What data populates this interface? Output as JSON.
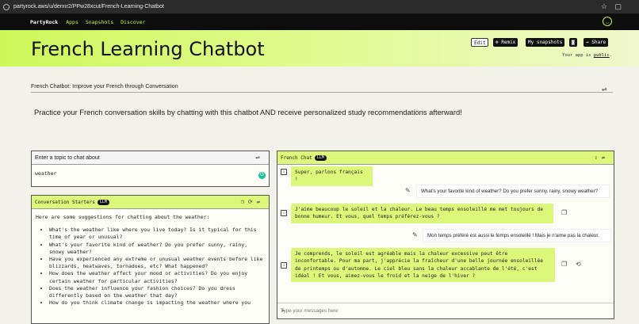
{
  "browser": {
    "url": "partyrock.aws/u/dennr2/PPw28xcut/French-Learning-Chatbot"
  },
  "nav": {
    "brand": "PartyRock",
    "links": [
      "Apps",
      "Snapshots",
      "Discover"
    ]
  },
  "header": {
    "title": "French Learning Chatbot",
    "buttons": {
      "edit": "Edit",
      "remix": "Remix",
      "my_snapshots": "My snapshots",
      "share": "Share"
    },
    "public_prefix": "Your app is ",
    "public_link": "public",
    "public_suffix": "."
  },
  "app": {
    "subtitle": "French Chatbot: Improve your French through Conversation",
    "lead": "Practice your French conversation skills by chatting with this chatbot AND receive personalized study recommendations afterward!"
  },
  "topic": {
    "label": "Enter a topic to chat about",
    "value": "weather"
  },
  "starters": {
    "title": "Conversation Starters",
    "badge": "LLM",
    "intro": "Here are some suggestions for chatting about the weather:",
    "items": [
      "What's the weather like where you live today? Is it typical for this time of year or unusual?",
      "What's your favorite kind of weather? Do you prefer sunny, rainy, snowy weather?",
      "Have you experienced any extreme or unusual weather events before like blizzards, heatwaves, tornadoes, etc? What happened?",
      "How does the weather affect your mood or activities? Do you enjoy certain weather for particular activities?",
      "Does the weather influence your fashion choices? Do you dress differently based on the weather that day?",
      "How do you think climate change is impacting the weather where you"
    ]
  },
  "chat": {
    "title": "French Chat",
    "badge": "LLM",
    "messages": [
      {
        "role": "bot",
        "text": "Super, parlons français !"
      },
      {
        "role": "user",
        "text": "What's your favorite kind of weather? Do you prefer sunny, rainy, snowy weather?"
      },
      {
        "role": "bot",
        "text": "J'aime beaucoup le soleil et la chaleur. Le beau temps ensoleillé me met toujours de bonne humeur. Et vous, quel temps préférez-vous ?"
      },
      {
        "role": "user",
        "text": "Mon temps préféré est aussi le temps ensoleillé ! Mais je n'aime pas la chaleur."
      },
      {
        "role": "bot",
        "text": "Je comprends, le soleil est agréable mais la chaleur excessive peut être inconfortable. Pour ma part, j'apprécie la fraîcheur d'une belle journée ensoleillée de printemps ou d'automne. Le ciel bleu sans la chaleur accablante de l'été, c'est idéal ! Et vous, aimez-vous le froid et la neige de l'hiver ?"
      }
    ],
    "placeholder": "Type your messages here"
  }
}
